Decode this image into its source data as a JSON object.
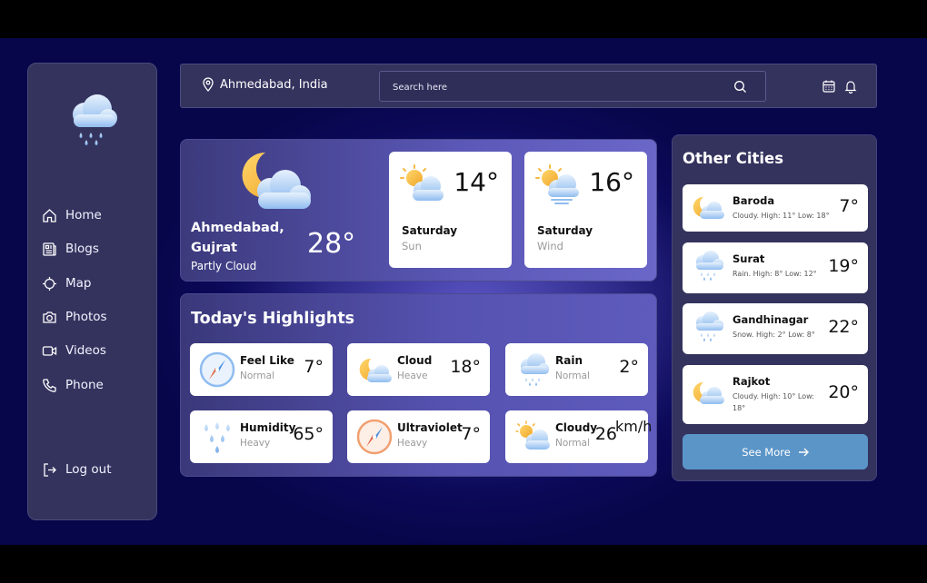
{
  "sidebar": {
    "items": [
      {
        "label": "Home",
        "icon": "home-icon"
      },
      {
        "label": "Blogs",
        "icon": "blogs-icon"
      },
      {
        "label": "Map",
        "icon": "map-icon"
      },
      {
        "label": "Photos",
        "icon": "camera-icon"
      },
      {
        "label": "Videos",
        "icon": "video-icon"
      },
      {
        "label": "Phone",
        "icon": "phone-icon"
      }
    ],
    "logout_label": "Log out"
  },
  "header": {
    "location": "Ahmedabad, India",
    "search_placeholder": "Search here"
  },
  "current": {
    "city_line1": "Ahmedabad,",
    "city_line2": "Gujrat",
    "description": "Partly Cloud",
    "temp": "28°"
  },
  "forecast": [
    {
      "temp": "14°",
      "day": "Saturday",
      "sub": "Sun"
    },
    {
      "temp": "16°",
      "day": "Saturday",
      "sub": "Wind"
    }
  ],
  "highlights": {
    "title": "Today's Highlights",
    "items": [
      {
        "name": "Feel Like",
        "sub": "Normal",
        "value": "7°",
        "icon": "compass-icon"
      },
      {
        "name": "Cloud",
        "sub": "Heave",
        "value": "18°",
        "icon": "moon-cloud-icon"
      },
      {
        "name": "Rain",
        "sub": "Normal",
        "value": "2°",
        "icon": "rain-cloud-icon"
      },
      {
        "name": "Humidity",
        "sub": "Heavy",
        "value": "65°",
        "icon": "raindrops-icon"
      },
      {
        "name": "Ultraviolet",
        "sub": "Heavy",
        "value": "7°",
        "icon": "compass-icon"
      },
      {
        "name": "Cloudy",
        "sub": "Normal",
        "value": "26",
        "unit": "km/h",
        "icon": "sun-cloud-icon"
      }
    ]
  },
  "other_cities": {
    "title": "Other Cities",
    "items": [
      {
        "city": "Baroda",
        "desc": "Cloudy. High: 11° Low: 18°",
        "temp": "7°",
        "icon": "moon-cloud-icon"
      },
      {
        "city": "Surat",
        "desc": "Rain. High: 8° Low: 12°",
        "temp": "19°",
        "icon": "rain-cloud-icon"
      },
      {
        "city": "Gandhinagar",
        "desc": "Snow. High: 2° Low: 8°",
        "temp": "22°",
        "icon": "rain-cloud-icon"
      },
      {
        "city": "Rajkot",
        "desc": "Cloudy. High: 10° Low: 18°",
        "temp": "20°",
        "icon": "moon-cloud-icon"
      }
    ],
    "see_more_label": "See More"
  },
  "colors": {
    "background": "#0c0a5a",
    "panel": "#34335e",
    "accent_button": "#5b95c8",
    "moon": "#f5b942",
    "cloud": "#a9cdf2"
  }
}
